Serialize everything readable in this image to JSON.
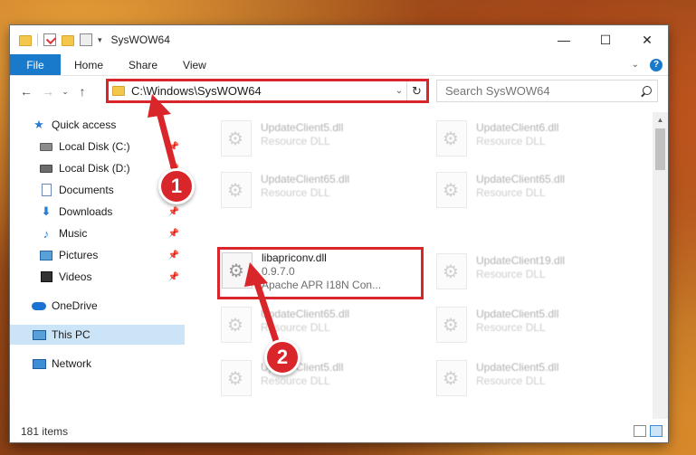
{
  "window": {
    "title": "SysWOW64",
    "controls": {
      "minimize": "—",
      "maximize": "☐",
      "close": "✕"
    }
  },
  "ribbon": {
    "tabs": [
      "File",
      "Home",
      "Share",
      "View"
    ],
    "help": "?"
  },
  "nav": {
    "back": "←",
    "forward": "→",
    "recent": "⌄",
    "up": "↑",
    "address": "C:\\Windows\\SysWOW64",
    "refresh": "↻",
    "search_placeholder": "Search SysWOW64"
  },
  "sidebar": {
    "items": [
      {
        "label": "Quick access",
        "icon": "star-icon",
        "pinned": false
      },
      {
        "label": "Local Disk (C:)",
        "icon": "disk-icon",
        "pinned": true
      },
      {
        "label": "Local Disk (D:)",
        "icon": "disk-icon",
        "pinned": true
      },
      {
        "label": "Documents",
        "icon": "documents-icon",
        "pinned": true
      },
      {
        "label": "Downloads",
        "icon": "downloads-icon",
        "pinned": true
      },
      {
        "label": "Music",
        "icon": "music-icon",
        "pinned": true
      },
      {
        "label": "Pictures",
        "icon": "pictures-icon",
        "pinned": true
      },
      {
        "label": "Videos",
        "icon": "videos-icon",
        "pinned": true
      },
      {
        "label": "OneDrive",
        "icon": "onedrive-icon",
        "pinned": false
      },
      {
        "label": "This PC",
        "icon": "this-pc-icon",
        "pinned": false,
        "selected": true
      },
      {
        "label": "Network",
        "icon": "network-icon",
        "pinned": false
      }
    ]
  },
  "files": [
    {
      "name": "UpdateClient5.dll",
      "type": "Resource DLL"
    },
    {
      "name": "UpdateClient6.dll",
      "type": "Resource DLL"
    },
    {
      "name": "UpdateClient65.dll",
      "type": "Resource DLL"
    },
    {
      "name": "UpdateClient65.dll",
      "type": "Resource DLL"
    },
    {
      "name": "libapriconv.dll",
      "version": "0.9.7.0",
      "description": "Apache APR I18N Con..."
    },
    {
      "name": "UpdateClient19.dll",
      "type": "Resource DLL"
    },
    {
      "name": "UpdateClient65.dll",
      "type": "Resource DLL"
    },
    {
      "name": "UpdateClient5.dll",
      "type": "Resource DLL"
    },
    {
      "name": "UpdateClient5.dll",
      "type": "Resource DLL"
    },
    {
      "name": "UpdateClient5.dll",
      "type": "Resource DLL"
    }
  ],
  "status": {
    "item_count": "181 items"
  },
  "annotations": {
    "step1": "1",
    "step2": "2"
  },
  "colors": {
    "accent": "#1979ca",
    "highlight": "#d9262a",
    "selection": "#cce4f7"
  }
}
